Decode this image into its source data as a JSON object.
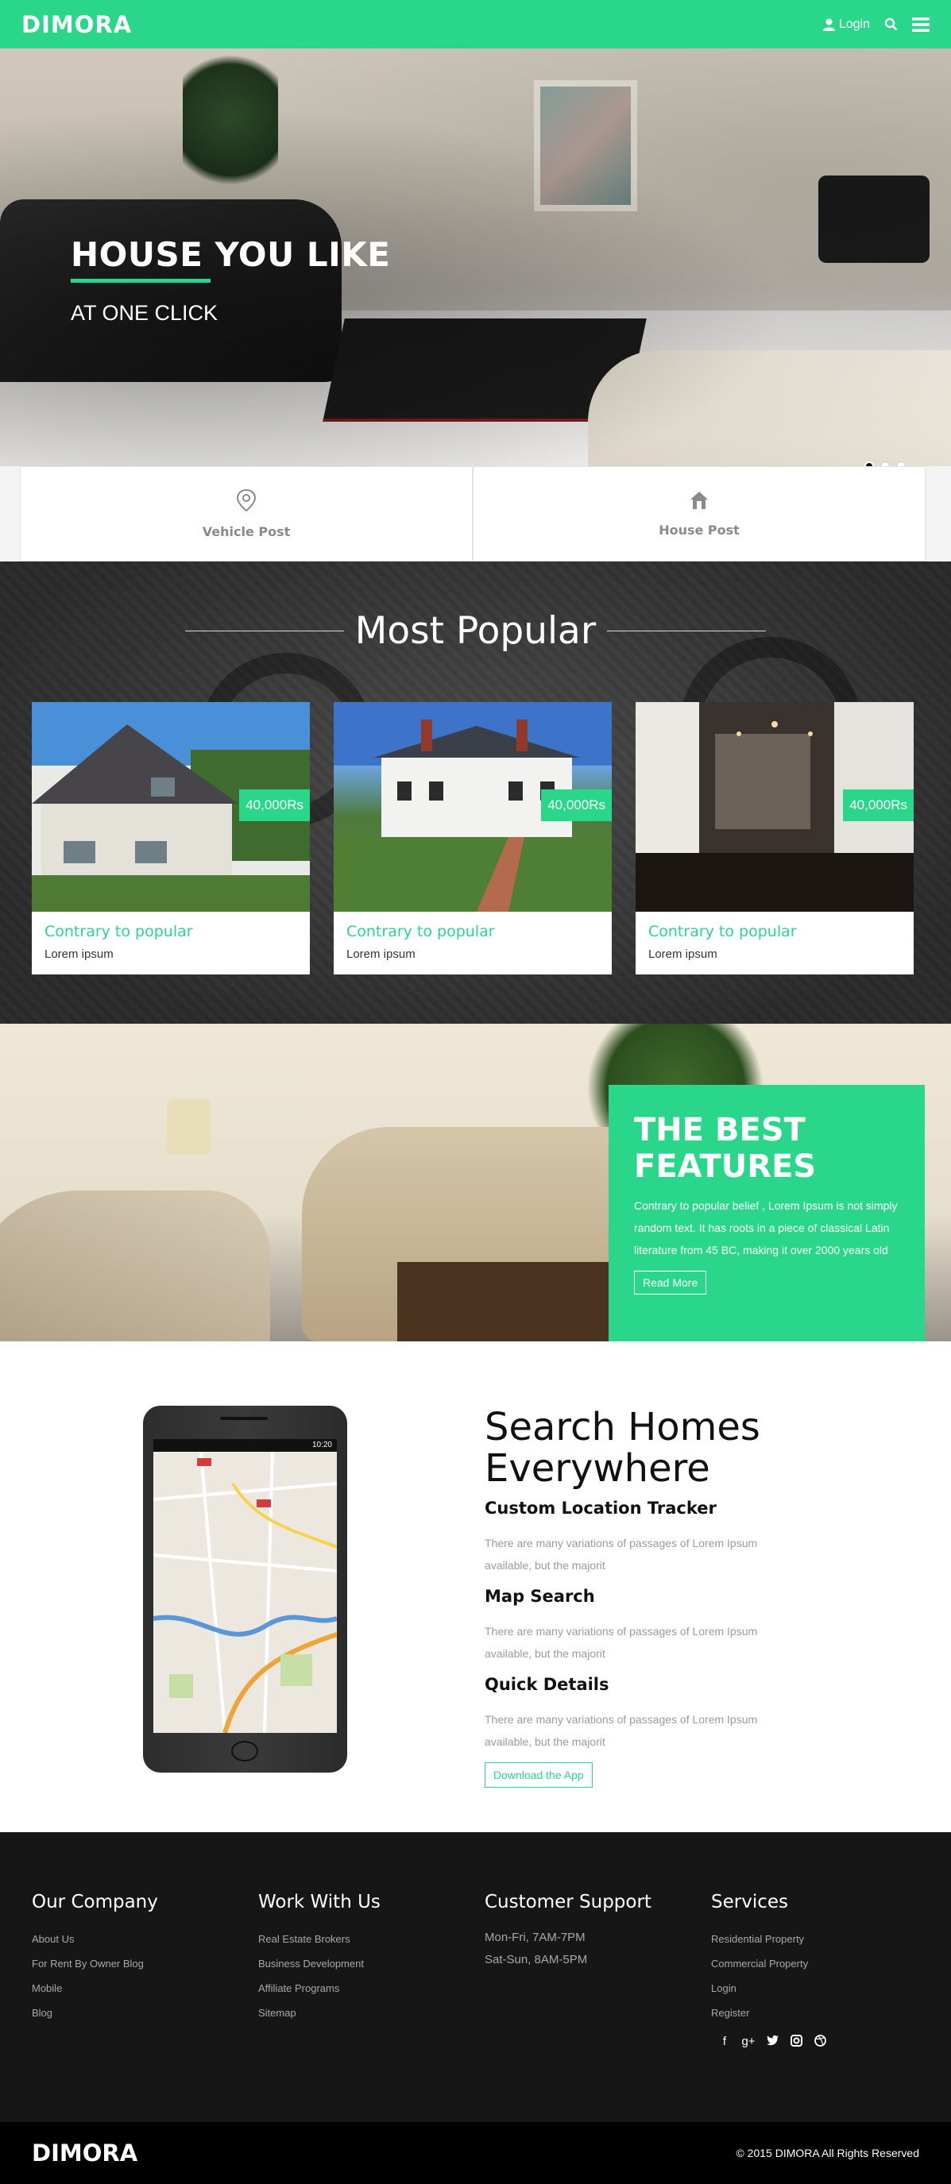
{
  "nav": {
    "brand": "DIMORA",
    "login_label": "Login",
    "search_icon": "search-icon",
    "menu_icon": "hamburger-icon",
    "accent": "#2ad68a"
  },
  "hero": {
    "title": "HOUSE YOU LIKE",
    "subtitle": "AT ONE CLICK",
    "slide_count": 3,
    "active_slide": 1
  },
  "posts": [
    {
      "label": "Vehicle Post",
      "icon": "location-pin-icon"
    },
    {
      "label": "House Post",
      "icon": "house-icon"
    }
  ],
  "popular": {
    "title": "Most Popular",
    "cards": [
      {
        "price": "40,000Rs",
        "title": "Contrary to popular",
        "subtitle": "Lorem ipsum"
      },
      {
        "price": "40,000Rs",
        "title": "Contrary to popular",
        "subtitle": "Lorem ipsum"
      },
      {
        "price": "40,000Rs",
        "title": "Contrary to popular",
        "subtitle": "Lorem ipsum"
      }
    ]
  },
  "features": {
    "title_line1": "THE BEST",
    "title_line2": "FEATURES",
    "text": "Contrary to popular belief , Lorem Ipsum is not simply random text. It has roots in a piece of classical Latin literature from 45 BC, making it over 2000 years old",
    "button": "Read More"
  },
  "search": {
    "title_line1": "Search Homes",
    "title_line2": "Everywhere",
    "phone_time": "10:20",
    "items": [
      {
        "heading": "Custom Location Tracker",
        "text": "There are many variations of passages of Lorem Ipsum available, but the majorit"
      },
      {
        "heading": "Map Search",
        "text": "There are many variations of passages of Lorem Ipsum available, but the majorit"
      },
      {
        "heading": "Quick Details",
        "text": "There are many variations of passages of Lorem Ipsum available, but the majorit"
      }
    ],
    "download_button": "Download the App"
  },
  "footer": {
    "company": {
      "heading": "Our Company",
      "links": [
        "About Us",
        "For Rent By Owner Blog",
        "Mobile",
        "Blog"
      ]
    },
    "work": {
      "heading": "Work With Us",
      "links": [
        "Real Estate Brokers",
        "Business Development",
        "Affiliate Programs",
        "Sitemap"
      ]
    },
    "support": {
      "heading": "Customer Support",
      "lines": [
        "Mon-Fri, 7AM-7PM",
        "Sat-Sun, 8AM-5PM"
      ]
    },
    "services": {
      "heading": "Services",
      "links": [
        "Residential Property",
        "Commercial Property",
        "Login",
        "Register"
      ]
    },
    "social": [
      "facebook-icon",
      "google-plus-icon",
      "twitter-icon",
      "instagram-icon",
      "dribbble-icon"
    ],
    "brand": "DIMORA",
    "copyright": "© 2015 DIMORA All Rights Reserved"
  }
}
